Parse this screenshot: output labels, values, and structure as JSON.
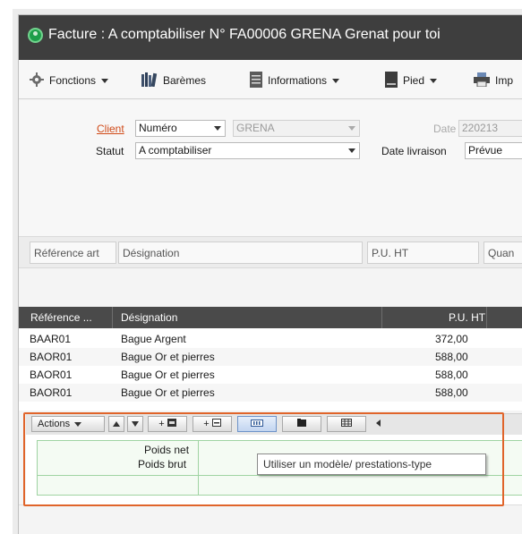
{
  "window": {
    "title": "Facture : A comptabiliser N° FA00006 GRENA Grenat pour toi",
    "colors": {
      "titlebar": "#3e3e3e",
      "accent_link": "#d04a18",
      "highlight": "#e0642a",
      "logo": "#1e9e4a"
    }
  },
  "toolbar": {
    "items": [
      {
        "label": "Fonctions",
        "icon": "gear-icon",
        "has_dropdown": true
      },
      {
        "label": "Barèmes",
        "icon": "books-icon",
        "has_dropdown": false
      },
      {
        "label": "Informations",
        "icon": "document-icon",
        "has_dropdown": true
      },
      {
        "label": "Pied",
        "icon": "page-icon",
        "has_dropdown": true
      },
      {
        "label": "Imp",
        "icon": "printer-icon",
        "has_dropdown": false
      }
    ]
  },
  "form": {
    "client_label": "Client",
    "client_type": "Numéro",
    "client_code": "GRENA",
    "date_label": "Date",
    "date_value": "220213",
    "statut_label": "Statut",
    "statut_value": "A comptabiliser",
    "livraison_label": "Date livraison",
    "livraison_value": "Prévue"
  },
  "entry": {
    "reference": "Référence art",
    "designation": "Désignation",
    "pu_ht": "P.U. HT",
    "quantite": "Quan"
  },
  "grid": {
    "columns": [
      "Référence ...",
      "Désignation",
      "P.U. HT"
    ],
    "rows": [
      {
        "ref": "BAAR01",
        "designation": "Bague Argent",
        "pu": "372,00"
      },
      {
        "ref": "BAOR01",
        "designation": "Bague Or et pierres",
        "pu": "588,00"
      },
      {
        "ref": "BAOR01",
        "designation": "Bague Or et pierres",
        "pu": "588,00"
      },
      {
        "ref": "BAOR01",
        "designation": "Bague Or et pierres",
        "pu": "588,00"
      }
    ]
  },
  "actions": {
    "actions_label": "Actions",
    "add_line_label": "+",
    "add_text_label": "+"
  },
  "pied": {
    "poids_net_label": "Poids net",
    "poids_brut_label": "Poids brut"
  },
  "tooltip": {
    "text": "Utiliser un modèle/ prestations-type"
  }
}
